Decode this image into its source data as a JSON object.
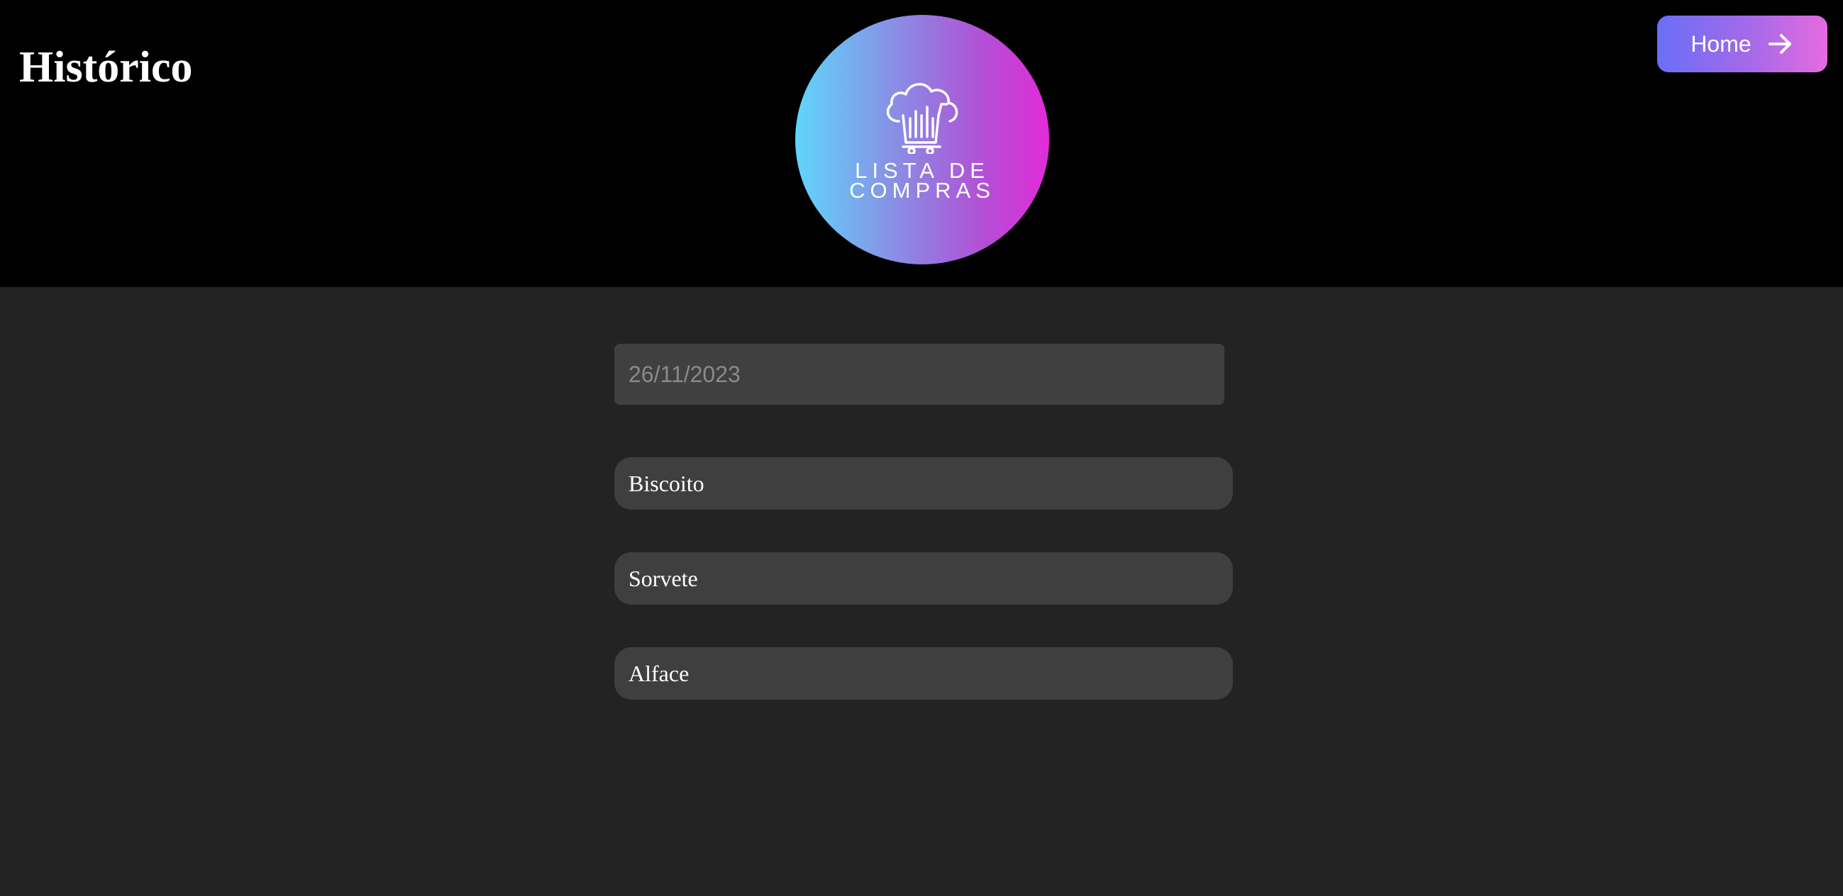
{
  "header": {
    "title": "Histórico",
    "logo": {
      "line1": "LISTA DE",
      "line2": "COMPRAS",
      "icon": "cloud-cart-icon",
      "gradient": [
        "#5fd6fa",
        "#b44ed5",
        "#e22bd8"
      ]
    },
    "home_button": {
      "label": "Home",
      "icon": "arrow-right-icon",
      "gradient": [
        "#6a6ef6",
        "#e66ae0"
      ]
    }
  },
  "main": {
    "date_input": {
      "value": "",
      "placeholder": "26/11/2023"
    },
    "items": [
      {
        "label": "Biscoito"
      },
      {
        "label": "Sorvete"
      },
      {
        "label": "Alface"
      }
    ]
  },
  "colors": {
    "header_bg": "#000000",
    "page_bg": "#232323",
    "field_bg": "#404040",
    "text": "#ffffff"
  }
}
